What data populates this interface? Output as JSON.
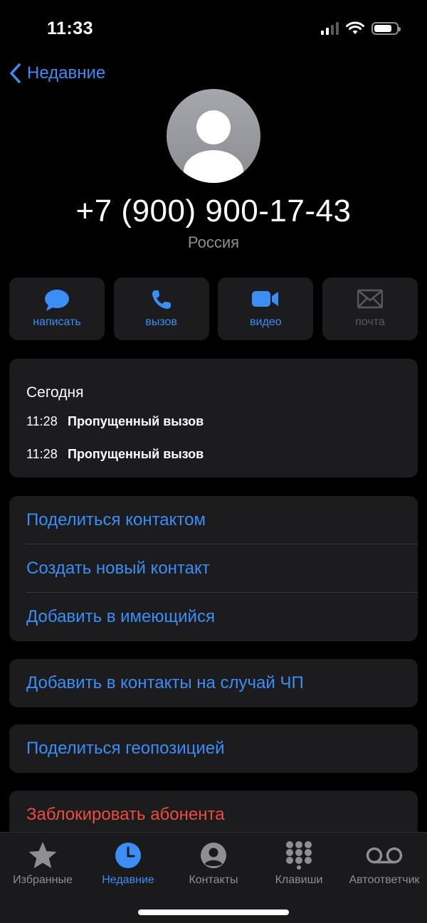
{
  "status": {
    "time": "11:33"
  },
  "nav": {
    "back_label": "Недавние"
  },
  "contact": {
    "phone": "+7 (900) 900-17-43",
    "country": "Россия"
  },
  "actions": [
    {
      "label": "написать",
      "icon": "message-icon",
      "enabled": true
    },
    {
      "label": "вызов",
      "icon": "phone-icon",
      "enabled": true
    },
    {
      "label": "видео",
      "icon": "video-icon",
      "enabled": true
    },
    {
      "label": "почта",
      "icon": "mail-icon",
      "enabled": false
    }
  ],
  "recents": {
    "title": "Сегодня",
    "calls": [
      {
        "time": "11:28",
        "desc": "Пропущенный вызов"
      },
      {
        "time": "11:28",
        "desc": "Пропущенный вызов"
      }
    ]
  },
  "menu": {
    "share_contact": "Поделиться контактом",
    "create_contact": "Создать новый контакт",
    "add_existing": "Добавить в имеющийся",
    "emergency": "Добавить в контакты на случай ЧП",
    "share_location": "Поделиться геопозицией",
    "block": "Заблокировать абонента"
  },
  "tabs": [
    {
      "label": "Избранные",
      "icon": "star-icon",
      "active": false
    },
    {
      "label": "Недавние",
      "icon": "clock-icon",
      "active": true
    },
    {
      "label": "Контакты",
      "icon": "person-circle-icon",
      "active": false
    },
    {
      "label": "Клавиши",
      "icon": "keypad-icon",
      "active": false
    },
    {
      "label": "Автоответчик",
      "icon": "voicemail-icon",
      "active": false
    }
  ],
  "colors": {
    "accent": "#3a8ef6",
    "destructive": "#eb4d3d",
    "card": "#1c1c1e",
    "background": "#000000"
  }
}
